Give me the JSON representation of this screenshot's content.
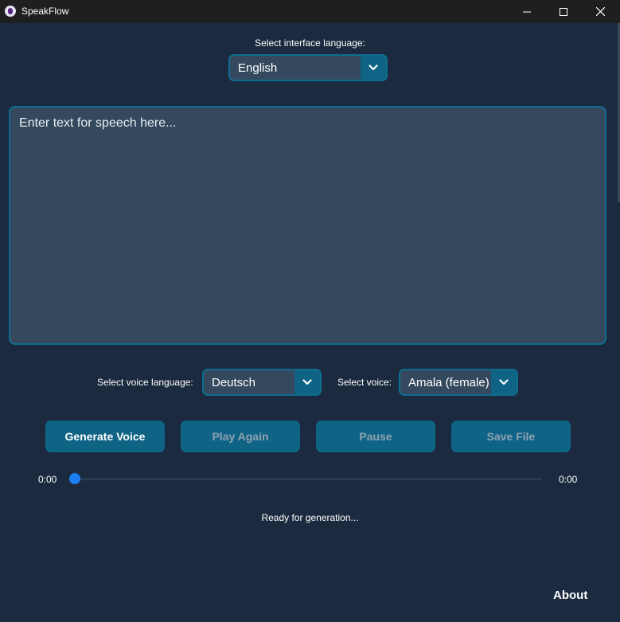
{
  "window": {
    "title": "SpeakFlow",
    "controls": [
      "minimize-icon",
      "maximize-icon",
      "close-icon"
    ]
  },
  "interface_language": {
    "label": "Select interface language:",
    "selected": "English"
  },
  "text_input": {
    "placeholder": "Enter text for speech here..."
  },
  "voice_language": {
    "label": "Select voice language:",
    "selected": "Deutsch"
  },
  "voice": {
    "label": "Select voice:",
    "selected": "Amala (female)"
  },
  "buttons": {
    "generate": "Generate Voice",
    "play_again": "Play Again",
    "pause": "Pause",
    "save_file": "Save File"
  },
  "player": {
    "current_time": "0:00",
    "total_time": "0:00",
    "progress": 0
  },
  "status": "Ready for generation...",
  "about": "About",
  "colors": {
    "background": "#1b2a3f",
    "input_bg": "#34495e",
    "accent": "#0f6385",
    "slider_thumb": "#1c7ef0"
  }
}
